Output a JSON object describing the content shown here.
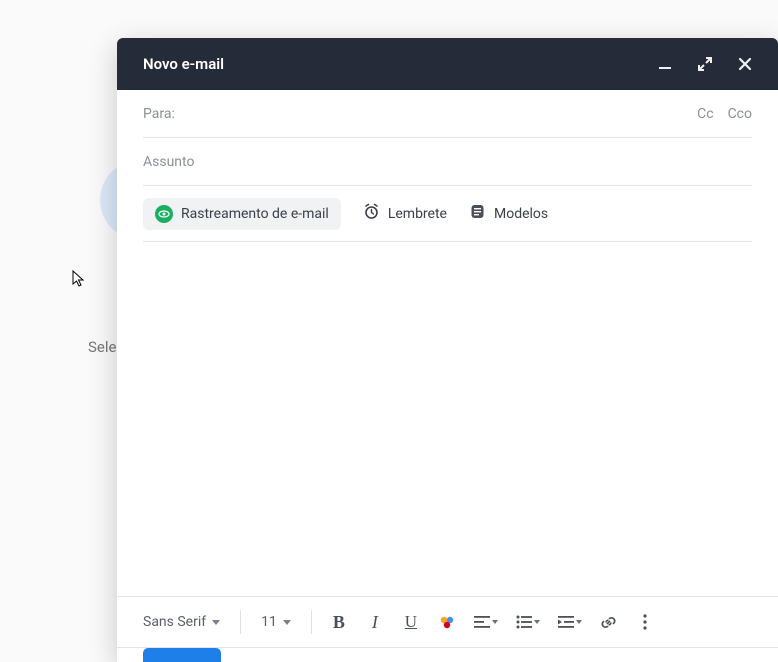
{
  "background": {
    "truncated_text": "Sele"
  },
  "header": {
    "title": "Novo e-mail"
  },
  "fields": {
    "to_label": "Para:",
    "cc_label": "Cc",
    "bcc_label": "Cco",
    "subject_placeholder": "Assunto"
  },
  "options": {
    "tracking": "Rastreamento de e-mail",
    "reminder": "Lembrete",
    "templates": "Modelos"
  },
  "toolbar": {
    "font_family": "Sans Serif",
    "font_size": "11",
    "bold": "B",
    "italic": "I",
    "underline": "U"
  }
}
